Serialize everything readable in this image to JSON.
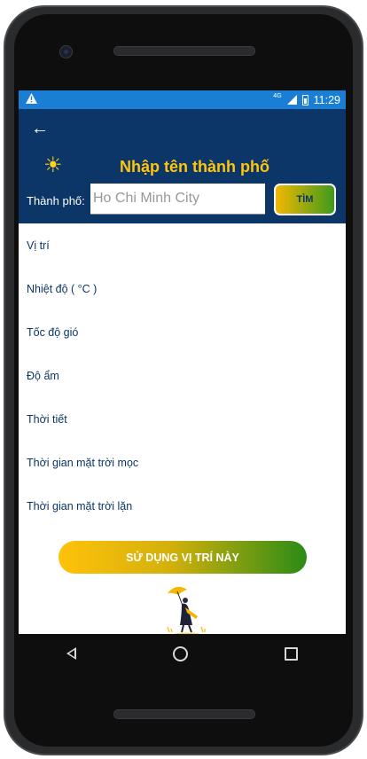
{
  "status_bar": {
    "alert_icon": "warning-icon",
    "network": "4G",
    "time": "11:29"
  },
  "header": {
    "back_icon": "arrow-left-icon",
    "weather_icon": "sun-icon",
    "title": "Nhập tên thành phố",
    "city_label": "Thành phố:",
    "city_input_value": "",
    "city_input_placeholder": "Ho Chi Minh City",
    "search_button": "TÌM"
  },
  "info_list": {
    "items": [
      {
        "label": "Vị trí"
      },
      {
        "label": "Nhiệt độ ( °C )"
      },
      {
        "label": "Tốc độ gió"
      },
      {
        "label": "Độ ẩm"
      },
      {
        "label": "Thời tiết"
      },
      {
        "label": "Thời gian mặt trời mọc"
      },
      {
        "label": "Thời gian mặt trời lặn"
      }
    ]
  },
  "use_location_button": "SỬ DỤNG VỊ TRÍ NÀY",
  "illustration_icon": "woman-with-umbrella-icon",
  "colors": {
    "header_bg": "#0b3667",
    "status_bg": "#1a7fd4",
    "title": "#ffc40f",
    "gradient_start": "#ffc20a",
    "gradient_end": "#2b8b16"
  }
}
